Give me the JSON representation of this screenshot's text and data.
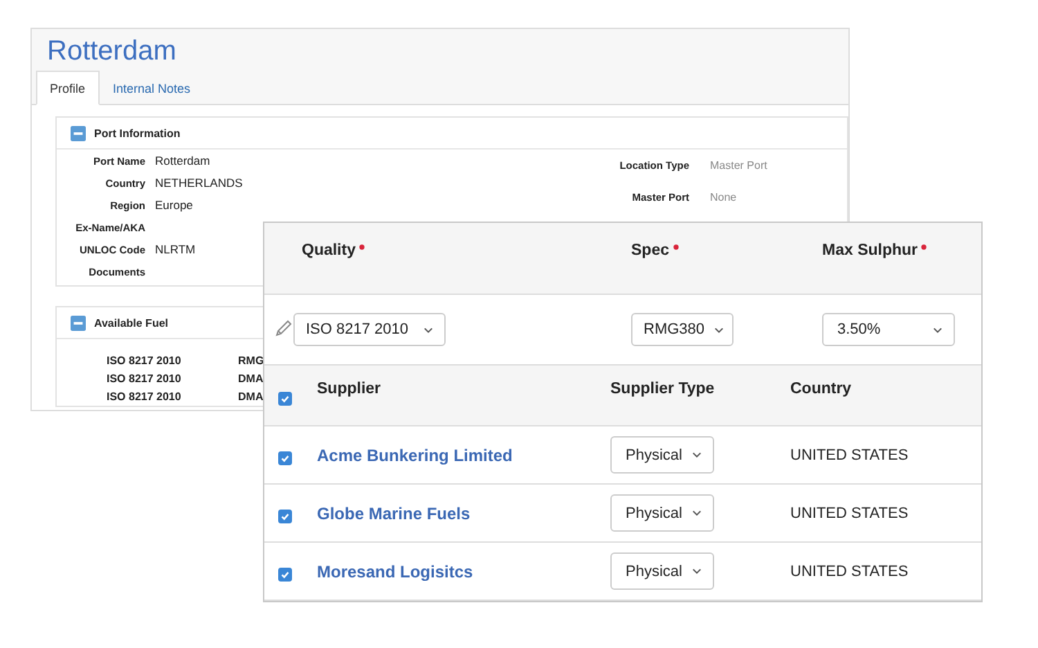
{
  "title": "Rotterdam",
  "tabs": [
    {
      "label": "Profile",
      "selected": true
    },
    {
      "label": "Internal Notes",
      "selected": false
    }
  ],
  "port_information": {
    "title": "Port Information",
    "expanded": true,
    "fields": [
      {
        "label": "Port Name",
        "value": "Rotterdam"
      },
      {
        "label": "Country",
        "value": "NETHERLANDS"
      },
      {
        "label": "Region",
        "value": "Europe"
      },
      {
        "label": "Ex-Name/AKA"
      },
      {
        "label": "UNLOC Code",
        "value": "NLRTM"
      },
      {
        "label": "Documents"
      }
    ],
    "side_fields": [
      {
        "label": "Location Type",
        "value": "Master Port"
      },
      {
        "label": "Master Port",
        "value": "None"
      }
    ]
  },
  "available_fuel": {
    "title": "Available Fuel",
    "expanded": true,
    "rows": [
      {
        "quality": "ISO 8217 2010",
        "spec": "RMG"
      },
      {
        "quality": "ISO 8217 2010",
        "spec": "DMA"
      },
      {
        "quality": "ISO 8217 2010",
        "spec": "DMA"
      }
    ]
  },
  "fuel_form": {
    "columns": [
      {
        "label": "Quality",
        "required": true,
        "value": "ISO 8217 2010"
      },
      {
        "label": "Spec",
        "required": true,
        "value": "RMG380"
      },
      {
        "label": "Max Sulphur",
        "required": true,
        "value": "3.50%"
      }
    ]
  },
  "suppliers": {
    "all_checked": true,
    "columns": [
      "Supplier",
      "Supplier Type",
      "Country"
    ],
    "rows": [
      {
        "checked": true,
        "name": "Acme Bunkering Limited",
        "type": "Physical",
        "country": "UNITED STATES"
      },
      {
        "checked": true,
        "name": "Globe Marine Fuels",
        "type": "Physical",
        "country": "UNITED STATES"
      },
      {
        "checked": true,
        "name": "Moresand Logisitcs",
        "type": "Physical",
        "country": "UNITED STATES"
      }
    ]
  }
}
